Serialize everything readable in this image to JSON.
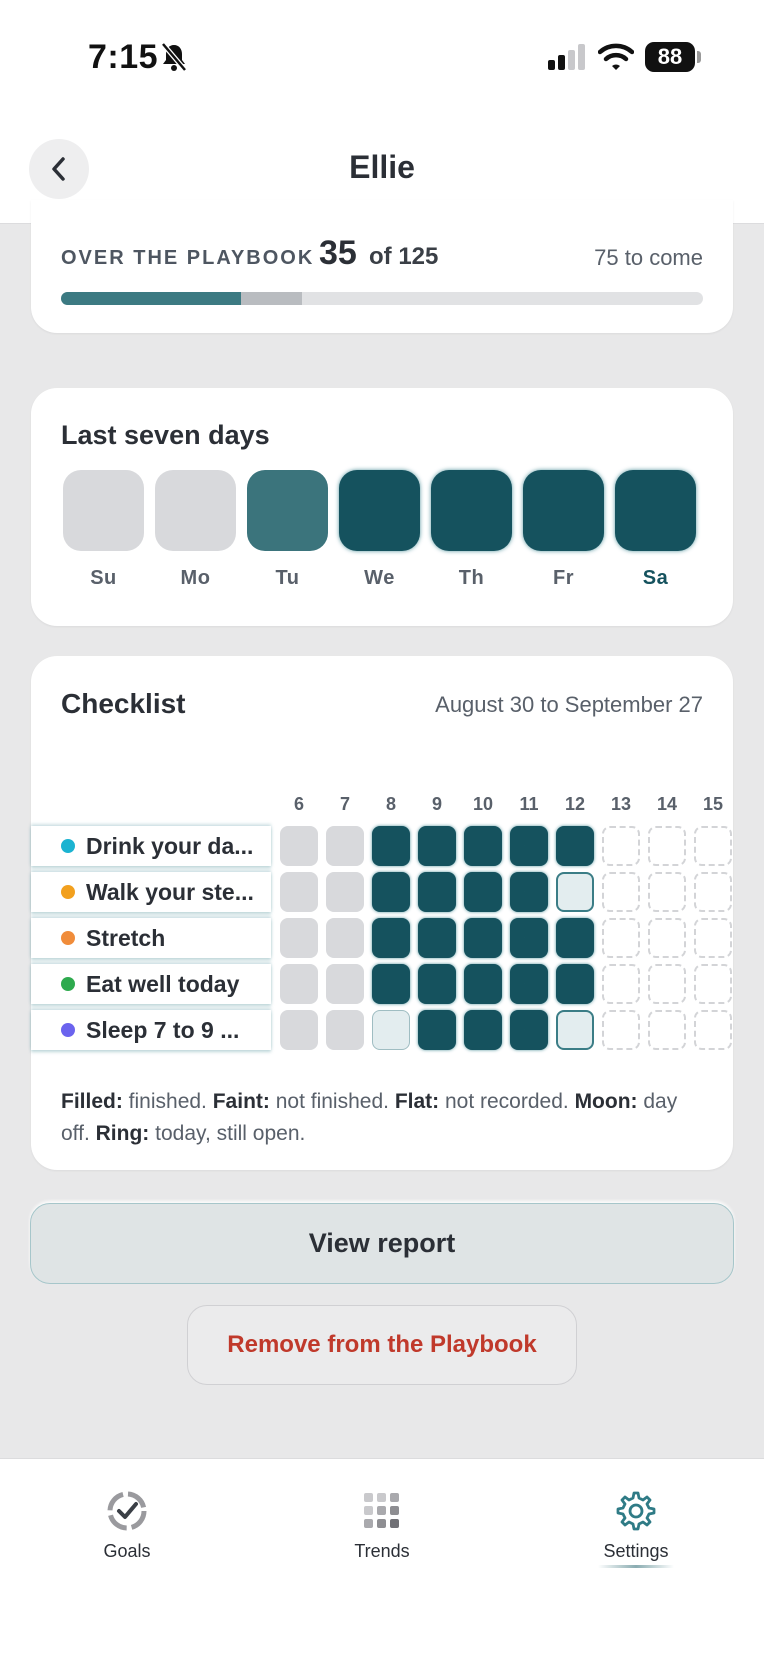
{
  "status_bar": {
    "time": "7:15",
    "battery": "88"
  },
  "header": {
    "title": "Ellie"
  },
  "overview": {
    "label": "OVER THE PLAYBOOK",
    "count": "35",
    "of_total": "of 125",
    "remaining": "75 to come",
    "progress_done_fraction": 0.28,
    "progress_pending_fraction": 0.095
  },
  "seven_days": {
    "title": "Last seven days",
    "days": [
      {
        "label": "Su",
        "state": "not-recorded",
        "day_off": false
      },
      {
        "label": "Mo",
        "state": "not-recorded",
        "day_off": false
      },
      {
        "label": "Tu",
        "state": "partial",
        "day_off": false
      },
      {
        "label": "We",
        "state": "finished",
        "day_off": true
      },
      {
        "label": "Th",
        "state": "finished",
        "day_off": true
      },
      {
        "label": "Fr",
        "state": "finished",
        "day_off": true
      },
      {
        "label": "Sa",
        "state": "finished",
        "day_off": false,
        "today": true
      }
    ]
  },
  "checklist": {
    "title": "Checklist",
    "range": "August 30 to September 27",
    "columns": [
      "6",
      "7",
      "8",
      "9",
      "10",
      "11",
      "12",
      "13",
      "14",
      "15"
    ],
    "rows": [
      {
        "label": "Drink your da...",
        "dot": "#1bb3d1",
        "cells": [
          "flat",
          "flat",
          "filled",
          "moon",
          "moon",
          "moon",
          "filled",
          "future",
          "future",
          "future"
        ]
      },
      {
        "label": "Walk your ste...",
        "dot": "#f2a01e",
        "cells": [
          "flat",
          "flat",
          "filled",
          "moon",
          "moon",
          "moon",
          "ring",
          "future",
          "future",
          "future"
        ]
      },
      {
        "label": "Stretch",
        "dot": "#f08c3a",
        "cells": [
          "flat",
          "flat",
          "filled",
          "moon",
          "moon",
          "moon",
          "filled",
          "future",
          "future",
          "future"
        ]
      },
      {
        "label": "Eat well today",
        "dot": "#2eaa4e",
        "cells": [
          "flat",
          "flat",
          "filled",
          "moon",
          "moon",
          "moon",
          "filled",
          "future",
          "future",
          "future"
        ]
      },
      {
        "label": "Sleep 7 to 9 ...",
        "dot": "#6b63ee",
        "cells": [
          "flat",
          "flat",
          "faint",
          "moon",
          "moon",
          "moon",
          "ring",
          "future",
          "future",
          "future"
        ]
      }
    ],
    "legend": [
      {
        "term": "Filled:",
        "desc": " finished. "
      },
      {
        "term": "Faint:",
        "desc": " not finished. "
      },
      {
        "term": "Flat:",
        "desc": " not recorded. "
      },
      {
        "term": "Moon:",
        "desc": " day off. "
      },
      {
        "term": "Ring:",
        "desc": " today, still open."
      }
    ]
  },
  "actions": {
    "report": "View report",
    "remove": "Remove from the Playbook"
  },
  "tabs": [
    {
      "label": "Goals",
      "icon": "goals-check-icon"
    },
    {
      "label": "Trends",
      "icon": "grid-icon"
    },
    {
      "label": "Settings",
      "icon": "gear-icon",
      "active": true
    }
  ],
  "colors": {
    "accent_dark": "#15525e",
    "accent_mid": "#3b747c",
    "danger": "#c0392b"
  }
}
